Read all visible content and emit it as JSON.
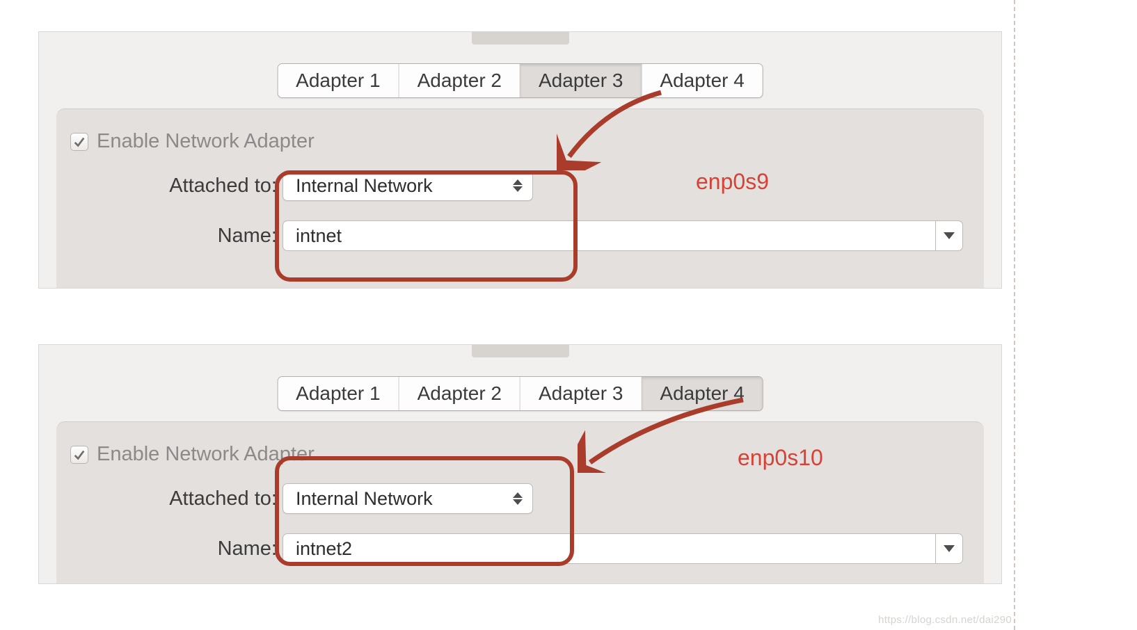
{
  "top": {
    "tabs": [
      "Adapter 1",
      "Adapter 2",
      "Adapter 3",
      "Adapter 4"
    ],
    "selectedIndex": 2,
    "enable_label": "Enable Network Adapter",
    "attached_label": "Attached to:",
    "attached_value": "Internal Network",
    "name_label": "Name:",
    "name_value": "intnet",
    "annotation": "enp0s9"
  },
  "bottom": {
    "tabs": [
      "Adapter 1",
      "Adapter 2",
      "Adapter 3",
      "Adapter 4"
    ],
    "selectedIndex": 3,
    "enable_label": "Enable Network Adapter",
    "attached_label": "Attached to:",
    "attached_value": "Internal Network",
    "name_label": "Name:",
    "name_value": "intnet2",
    "annotation": "enp0s10"
  },
  "watermark": "https://blog.csdn.net/dai290"
}
